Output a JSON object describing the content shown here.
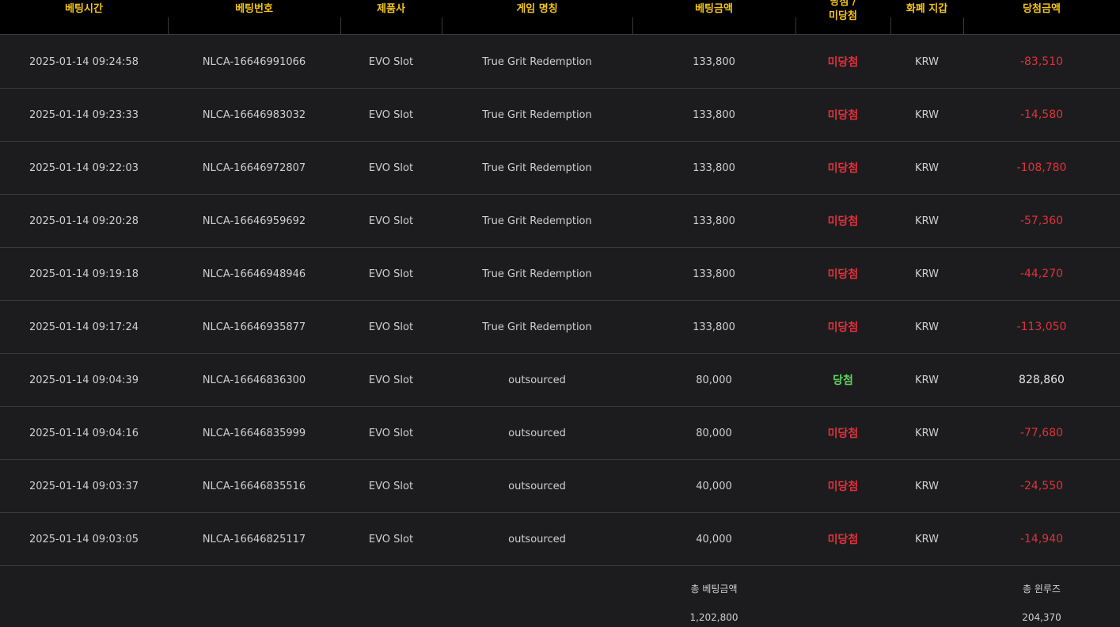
{
  "header": {
    "bet_time": "베팅시간",
    "bet_number": "베팅번호",
    "provider": "제품사",
    "game_name": "게임 명칭",
    "bet_amount": "베팅금액",
    "result_line1": "당첨 /",
    "result_line2": "미당첨",
    "currency_wallet": "화폐 지갑",
    "win_amount": "당첨금액"
  },
  "colors": {
    "header_text": "#f5c518",
    "lose": "#e0323c",
    "win": "#5fd35f",
    "background": "#1c1c1e"
  },
  "rows": [
    {
      "time": "2025-01-14 09:24:58",
      "number": "NLCA-16646991066",
      "provider": "EVO Slot",
      "game": "True Grit Redemption",
      "bet": "133,800",
      "result": "미당첨",
      "currency": "KRW",
      "amount": "-83,510"
    },
    {
      "time": "2025-01-14 09:23:33",
      "number": "NLCA-16646983032",
      "provider": "EVO Slot",
      "game": "True Grit Redemption",
      "bet": "133,800",
      "result": "미당첨",
      "currency": "KRW",
      "amount": "-14,580"
    },
    {
      "time": "2025-01-14 09:22:03",
      "number": "NLCA-16646972807",
      "provider": "EVO Slot",
      "game": "True Grit Redemption",
      "bet": "133,800",
      "result": "미당첨",
      "currency": "KRW",
      "amount": "-108,780"
    },
    {
      "time": "2025-01-14 09:20:28",
      "number": "NLCA-16646959692",
      "provider": "EVO Slot",
      "game": "True Grit Redemption",
      "bet": "133,800",
      "result": "미당첨",
      "currency": "KRW",
      "amount": "-57,360"
    },
    {
      "time": "2025-01-14 09:19:18",
      "number": "NLCA-16646948946",
      "provider": "EVO Slot",
      "game": "True Grit Redemption",
      "bet": "133,800",
      "result": "미당첨",
      "currency": "KRW",
      "amount": "-44,270"
    },
    {
      "time": "2025-01-14 09:17:24",
      "number": "NLCA-16646935877",
      "provider": "EVO Slot",
      "game": "True Grit Redemption",
      "bet": "133,800",
      "result": "미당첨",
      "currency": "KRW",
      "amount": "-113,050"
    },
    {
      "time": "2025-01-14 09:04:39",
      "number": "NLCA-16646836300",
      "provider": "EVO Slot",
      "game": "outsourced",
      "bet": "80,000",
      "result": "당첨",
      "currency": "KRW",
      "amount": "828,860"
    },
    {
      "time": "2025-01-14 09:04:16",
      "number": "NLCA-16646835999",
      "provider": "EVO Slot",
      "game": "outsourced",
      "bet": "80,000",
      "result": "미당첨",
      "currency": "KRW",
      "amount": "-77,680"
    },
    {
      "time": "2025-01-14 09:03:37",
      "number": "NLCA-16646835516",
      "provider": "EVO Slot",
      "game": "outsourced",
      "bet": "40,000",
      "result": "미당첨",
      "currency": "KRW",
      "amount": "-24,550"
    },
    {
      "time": "2025-01-14 09:03:05",
      "number": "NLCA-16646825117",
      "provider": "EVO Slot",
      "game": "outsourced",
      "bet": "40,000",
      "result": "미당첨",
      "currency": "KRW",
      "amount": "-14,940"
    }
  ],
  "footer": {
    "total_bet_label": "총 베팅금액",
    "total_bet_value": "1,202,800",
    "total_winloss_label": "총 윈루즈",
    "total_winloss_value": "204,370"
  }
}
